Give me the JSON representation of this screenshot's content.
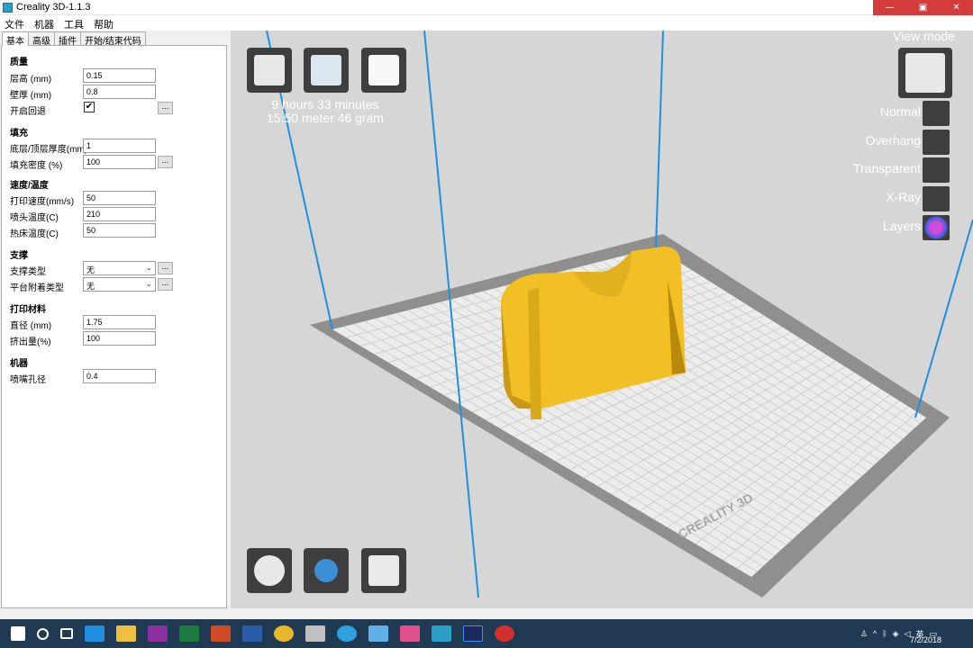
{
  "window": {
    "title": "Creality 3D-1.1.3"
  },
  "menu": [
    "文件",
    "机器",
    "工具",
    "帮助"
  ],
  "tabs": [
    "基本",
    "高级",
    "插件",
    "开始/结束代码"
  ],
  "settings": {
    "quality": {
      "header": "质量",
      "layer_height_label": "层高 (mm)",
      "layer_height": "0.15",
      "wall_thickness_label": "壁厚 (mm)",
      "wall_thickness": "0.8",
      "retraction_label": "开启回退",
      "retraction_checked": "✔"
    },
    "fill": {
      "header": "填充",
      "bottom_top_label": "底层/顶层厚度(mm)",
      "bottom_top": "1",
      "density_label": "填充密度 (%)",
      "density": "100"
    },
    "speed_temp": {
      "header": "速度/温度",
      "print_speed_label": "打印速度(mm/s)",
      "print_speed": "50",
      "nozzle_temp_label": "喷头温度(C)",
      "nozzle_temp": "210",
      "bed_temp_label": "热床温度(C)",
      "bed_temp": "50"
    },
    "support": {
      "header": "支撑",
      "support_type_label": "支撑类型",
      "support_type": "无",
      "adhesion_label": "平台附着类型",
      "adhesion": "无"
    },
    "filament": {
      "header": "打印材料",
      "diameter_label": "直径 (mm)",
      "diameter": "1.75",
      "flow_label": "挤出量(%)",
      "flow": "100"
    },
    "machine": {
      "header": "机器",
      "nozzle_label": "喷嘴孔径",
      "nozzle": "0.4"
    },
    "more_label": "..."
  },
  "print_info": {
    "time": "9 hours 33 minutes",
    "material": "15.50 meter 46 gram"
  },
  "view_mode": {
    "title": "View mode",
    "modes": [
      "Normal",
      "Overhang",
      "Transparent",
      "X-Ray",
      "Layers"
    ]
  },
  "bed_logo": "CREALITY 3D",
  "taskbar": {
    "time": "",
    "date": "7/2/2018",
    "lang": "英"
  },
  "colors": {
    "model": "#f5c52a",
    "bed": "#ececec",
    "bed_border": "#8f8f8f",
    "background": "#d6d6d6",
    "build_lines": "#1f8fe0"
  }
}
